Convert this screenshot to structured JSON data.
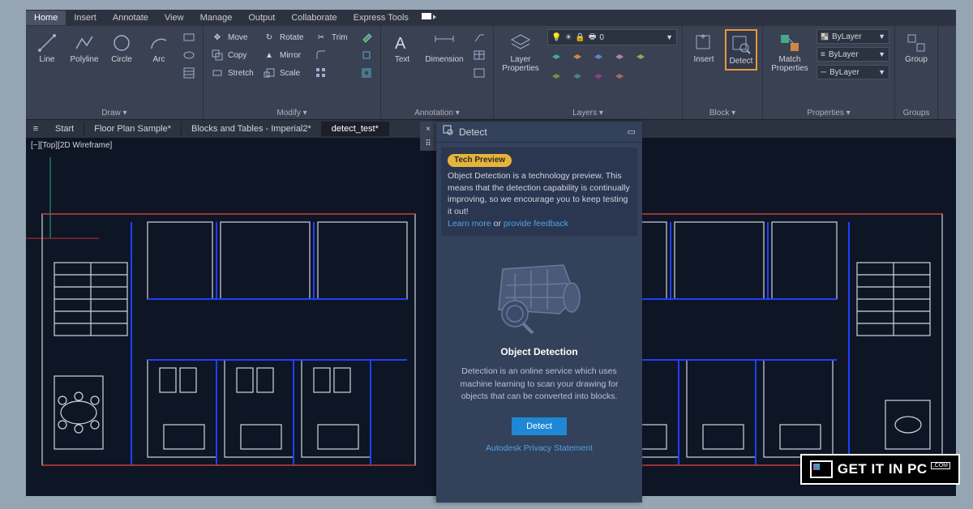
{
  "menu": {
    "tabs": [
      "Home",
      "Insert",
      "Annotate",
      "View",
      "Manage",
      "Output",
      "Collaborate",
      "Express Tools"
    ]
  },
  "ribbon": {
    "draw": {
      "label": "Draw ▾",
      "line": "Line",
      "polyline": "Polyline",
      "circle": "Circle",
      "arc": "Arc"
    },
    "modify": {
      "label": "Modify ▾",
      "move": "Move",
      "copy": "Copy",
      "stretch": "Stretch",
      "rotate": "Rotate",
      "mirror": "Mirror",
      "scale": "Scale",
      "trim": "Trim"
    },
    "annotation": {
      "label": "Annotation ▾",
      "text": "Text",
      "dimension": "Dimension"
    },
    "layers": {
      "label": "Layers ▾",
      "layer_properties": "Layer Properties",
      "current": "0"
    },
    "block": {
      "label": "Block ▾",
      "insert": "Insert",
      "detect": "Detect"
    },
    "properties": {
      "label": "Properties ▾",
      "match": "Match Properties",
      "bylayer1": "ByLayer",
      "bylayer2": "ByLayer",
      "bylayer3": "ByLayer"
    },
    "groups": {
      "label": "Groups",
      "group": "Group"
    }
  },
  "file_tabs": {
    "start": "Start",
    "t1": "Floor Plan Sample*",
    "t2": "Blocks and Tables - Imperial2*",
    "t3": "detect_test*"
  },
  "viewport": {
    "label": "[−][Top][2D Wireframe]"
  },
  "detect_panel": {
    "title": "Detect",
    "badge": "Tech Preview",
    "note": "Object Detection is a technology preview. This means that the detection capability is continually improving, so we encourage you to keep testing it out!",
    "learn": "Learn more",
    "or": " or ",
    "feedback": "provide feedback",
    "heading": "Object Detection",
    "desc": "Detection is an online service which uses machine learning to scan your drawing for objects that can be converted into blocks.",
    "button": "Detect",
    "privacy": "Autodesk Privacy Statement"
  },
  "watermark": {
    "text": "GET IT IN PC",
    "sub": ".COM"
  }
}
